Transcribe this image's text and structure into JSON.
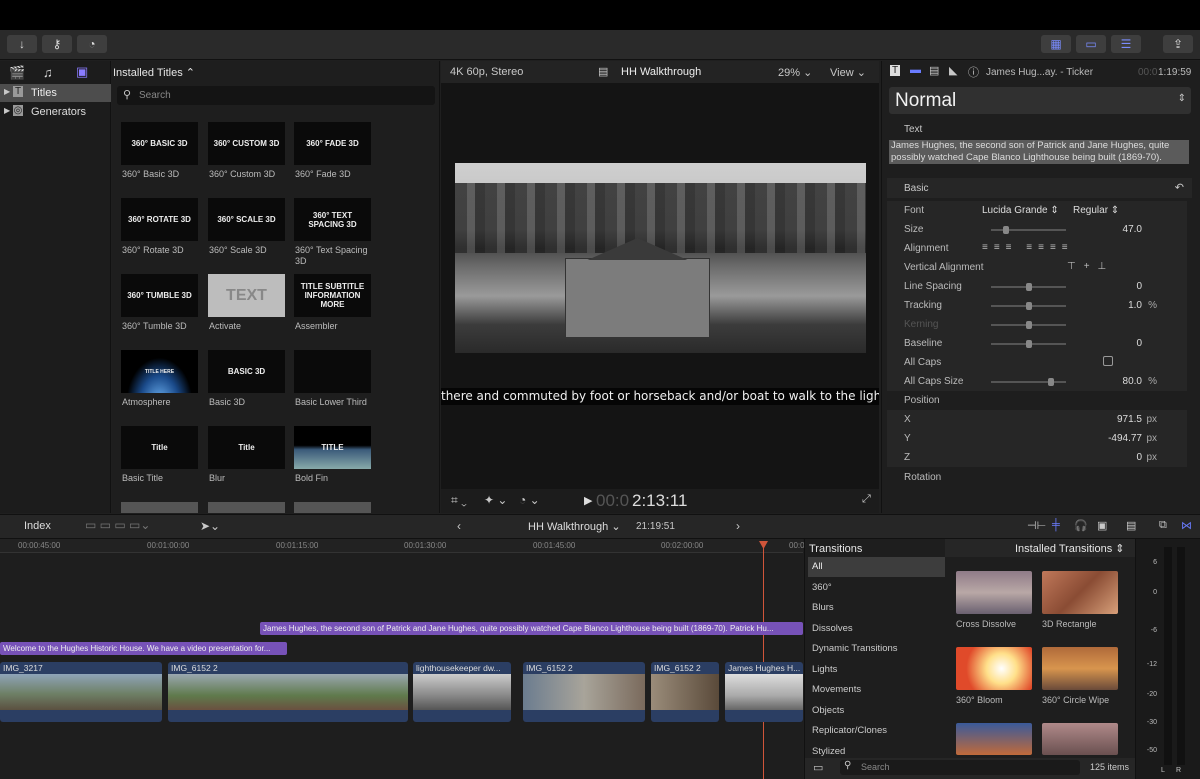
{
  "toolbar": {
    "buttons": [
      "import-icon",
      "keywords-icon",
      "background-tasks-icon"
    ],
    "right_buttons": [
      "browser-layout-icon",
      "timeline-layout-icon",
      "inspector-layout-icon"
    ],
    "share": "share-icon"
  },
  "library": {
    "items": [
      {
        "label": "Titles",
        "icon": "titles-icon"
      },
      {
        "label": "Generators",
        "icon": "generators-icon"
      }
    ]
  },
  "browser": {
    "header": "Installed Titles",
    "search_placeholder": "Search",
    "tiles": [
      {
        "thumb": "360° BASIC 3D",
        "label": "360° Basic 3D"
      },
      {
        "thumb": "360° CUSTOM 3D",
        "label": "360° Custom 3D"
      },
      {
        "thumb": "360° FADE 3D",
        "label": "360° Fade 3D"
      },
      {
        "thumb": "360° ROTATE 3D",
        "label": "360° Rotate 3D"
      },
      {
        "thumb": "360° SCALE 3D",
        "label": "360° Scale 3D"
      },
      {
        "thumb": "360° TEXT SPACING 3D",
        "label": "360° Text Spacing 3D"
      },
      {
        "thumb": "360° TUMBLE 3D",
        "label": "360° Tumble 3D"
      },
      {
        "thumb": "TEXT",
        "label": "Activate"
      },
      {
        "thumb": "TITLE SUBTITLE INFORMATION MORE",
        "label": "Assembler"
      },
      {
        "thumb": "TITLE HERE",
        "label": "Atmosphere"
      },
      {
        "thumb": "BASIC 3D",
        "label": "Basic 3D"
      },
      {
        "thumb": "",
        "label": "Basic Lower Third"
      },
      {
        "thumb": "Title",
        "label": "Basic Title"
      },
      {
        "thumb": "Title",
        "label": "Blur"
      },
      {
        "thumb": "TITLE",
        "label": "Bold Fin"
      }
    ]
  },
  "viewer": {
    "format": "4K 60p, Stereo",
    "project": "HH Walkthrough",
    "zoom": "29%",
    "view": "View",
    "caption": "there and commuted by foot or horseback and/or boat to walk to the lighthouse.",
    "timecode_dim": "00:0",
    "timecode": "2:13:11"
  },
  "inspector": {
    "clip_name": "James Hug...ay. - Ticker",
    "duration_dim": "00:0",
    "duration": "1:19:59",
    "preset": "Normal",
    "text_label": "Text",
    "text_value": "James Hughes, the second son of Patrick and Jane Hughes, quite possibly watched Cape Blanco Lighthouse being built (1869-70).",
    "section": "Basic",
    "font_label": "Font",
    "font": "Lucida Grande",
    "font_style": "Regular",
    "rows": [
      {
        "label": "Size",
        "value": "47.0",
        "unit": "",
        "knob": 0.2
      },
      {
        "label": "Alignment",
        "value": "",
        "unit": ""
      },
      {
        "label": "Vertical Alignment",
        "value": "",
        "unit": ""
      },
      {
        "label": "Line Spacing",
        "value": "0",
        "unit": "",
        "knob": 0.5
      },
      {
        "label": "Tracking",
        "value": "1.0",
        "unit": "%",
        "knob": 0.5
      },
      {
        "label": "Kerning",
        "value": "",
        "unit": "",
        "knob": 0.5
      },
      {
        "label": "Baseline",
        "value": "0",
        "unit": "",
        "knob": 0.5
      },
      {
        "label": "All Caps",
        "value": "",
        "unit": ""
      },
      {
        "label": "All Caps Size",
        "value": "80.0",
        "unit": "%",
        "knob": 0.8
      }
    ],
    "position_label": "Position",
    "x_label": "X",
    "x": "971.5",
    "y_label": "Y",
    "y": "-494.77",
    "z_label": "Z",
    "z": "0",
    "px": "px",
    "rotation_label": "Rotation"
  },
  "timeline": {
    "index": "Index",
    "project": "HH Walkthrough",
    "duration": "21:19:51",
    "ruler": [
      "00:00:45:00",
      "00:01:00:00",
      "00:01:15:00",
      "00:01:30:00",
      "00:01:45:00",
      "00:02:00:00",
      "00:0"
    ],
    "title_clips": [
      "James Hughes, the second son of Patrick and Jane Hughes, quite possibly watched Cape Blanco Lighthouse being built (1869-70). Patrick Hu...",
      "Welcome to the Hughes Historic House. We have a video presentation for..."
    ],
    "clips": [
      "IMG_3217",
      "IMG_6152 2",
      "lighthousekeeper dw...",
      "IMG_6152 2",
      "IMG_6152 2",
      "James Hughes H..."
    ]
  },
  "transitions": {
    "header": "Transitions",
    "installed": "Installed Transitions",
    "categories": [
      "All",
      "360°",
      "Blurs",
      "Dissolves",
      "Dynamic Transitions",
      "Lights",
      "Movements",
      "Objects",
      "Replicator/Clones",
      "Stylized"
    ],
    "tiles": [
      "Cross Dissolve",
      "3D Rectangle",
      "360° Bloom",
      "360° Circle Wipe"
    ],
    "search_placeholder": "Search",
    "count": "125 items"
  },
  "meters": {
    "ticks": [
      "6",
      "0",
      "-6",
      "-12",
      "-20",
      "-30",
      "-50"
    ],
    "channels": [
      "L",
      "R"
    ]
  }
}
